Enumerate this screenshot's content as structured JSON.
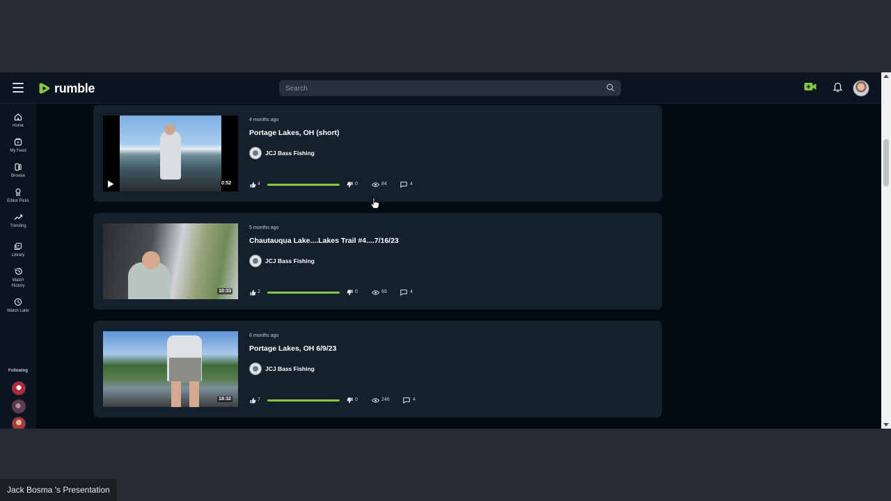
{
  "header": {
    "brand": "rumble",
    "search_placeholder": "Search"
  },
  "colors": {
    "brand_green": "#85c742",
    "background": "#030b13",
    "card": "#14212d"
  },
  "sidebar": {
    "items": [
      {
        "label": "Home",
        "icon": "home-icon"
      },
      {
        "label": "My Feed",
        "icon": "feed-icon"
      },
      {
        "label": "Browse",
        "icon": "browse-icon"
      },
      {
        "label": "Editor Picks",
        "icon": "award-icon"
      },
      {
        "label": "Trending",
        "icon": "trending-icon"
      },
      {
        "label": "Library",
        "icon": "library-icon"
      },
      {
        "label": "Watch History",
        "icon": "history-icon"
      },
      {
        "label": "Watch Later",
        "icon": "clock-icon"
      }
    ],
    "following_label": "Following"
  },
  "videos": [
    {
      "ago": "4 months ago",
      "title": "Portage Lakes, OH (short)",
      "channel": "JCJ Bass Fishing",
      "duration": "0:52",
      "likes": "4",
      "dislikes": "0",
      "views": "84",
      "comments": "4"
    },
    {
      "ago": "5 months ago",
      "title": "Chautauqua Lake....Lakes Trail #4....7/16/23",
      "channel": "JCJ Bass Fishing",
      "duration": "10:33",
      "likes": "2",
      "dislikes": "0",
      "views": "69",
      "comments": "4"
    },
    {
      "ago": "6 months ago",
      "title": "Portage Lakes, OH 6/9/23",
      "channel": "JCJ Bass Fishing",
      "duration": "18:32",
      "likes": "7",
      "dislikes": "0",
      "views": "246",
      "comments": "4"
    }
  ],
  "presenter_label": "Jack Bosma 's Presentation"
}
